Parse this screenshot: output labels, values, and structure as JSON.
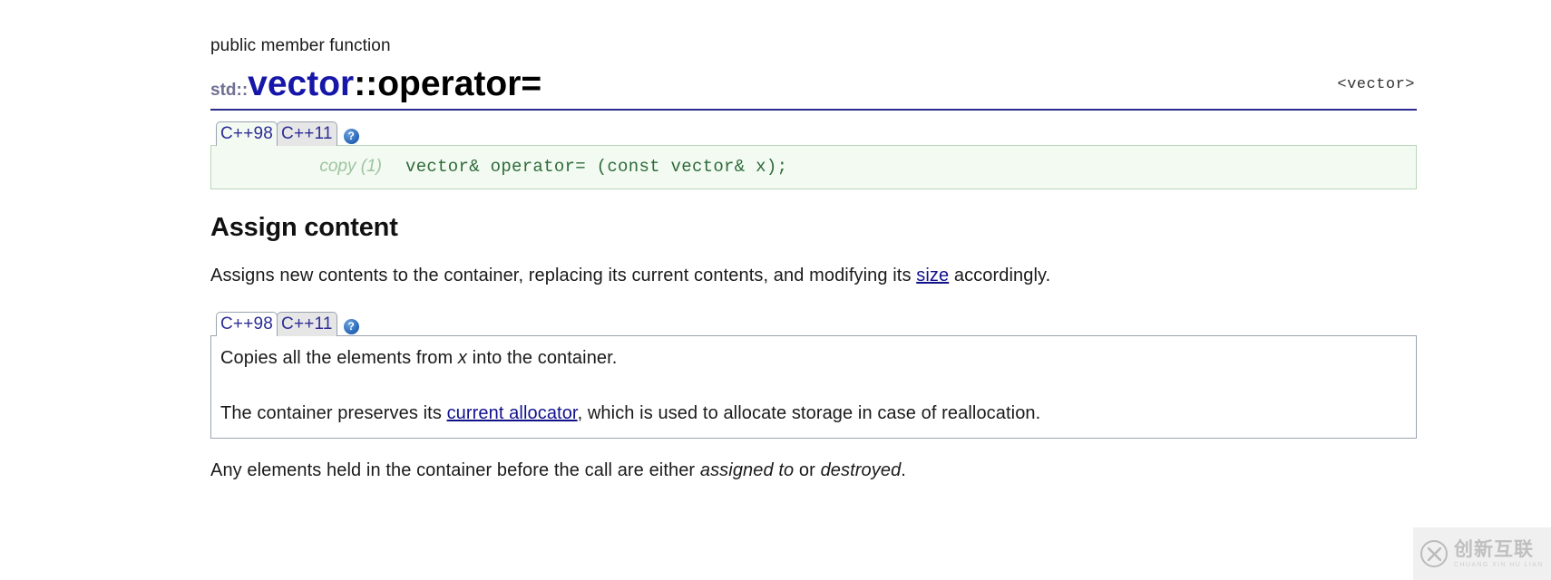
{
  "header": {
    "kind": "public member function",
    "namespace": "std::",
    "class_name": "vector",
    "separator": "::",
    "member": "operator=",
    "header_file": "<vector>"
  },
  "signature_block": {
    "tabs": [
      {
        "label": "C++98",
        "active": true
      },
      {
        "label": "C++11",
        "active": false
      }
    ],
    "info_icon": "question-mark-icon",
    "info_glyph": "?",
    "rows": [
      {
        "number_label": "copy (1)",
        "code": "vector& operator= (const vector& x);"
      }
    ]
  },
  "section": {
    "heading": "Assign content",
    "description": {
      "before_link": "Assigns new contents to the container, replacing its current contents, and modifying its ",
      "link_text": "size",
      "after_link": " accordingly."
    }
  },
  "detail_block": {
    "tabs": [
      {
        "label": "C++98",
        "active": true
      },
      {
        "label": "C++11",
        "active": false
      }
    ],
    "info_icon": "question-mark-icon",
    "info_glyph": "?",
    "paragraphs": {
      "p1_a": "Copies all the elements from ",
      "p1_em": "x",
      "p1_b": " into the container.",
      "p2_a": "The container preserves its ",
      "p2_link": "current allocator",
      "p2_b": ", which is used to allocate storage in case of reallocation."
    }
  },
  "footer_note": {
    "a": "Any elements held in the container before the call are either ",
    "em1": "assigned to",
    "b": " or ",
    "em2": "destroyed",
    "c": "."
  },
  "watermark": {
    "cn_text": "创新互联",
    "pinyin_text": "CHUANG XIN HU LIAN"
  },
  "colors": {
    "title_blue": "#11118c",
    "rule_blue": "#2b2b8f",
    "code_green": "#2f6b39",
    "panel_green_bg": "#f2faf2",
    "link_blue": "#11118c",
    "tab_text": "#2d2d96",
    "info_icon_blue": "#2463b5"
  }
}
